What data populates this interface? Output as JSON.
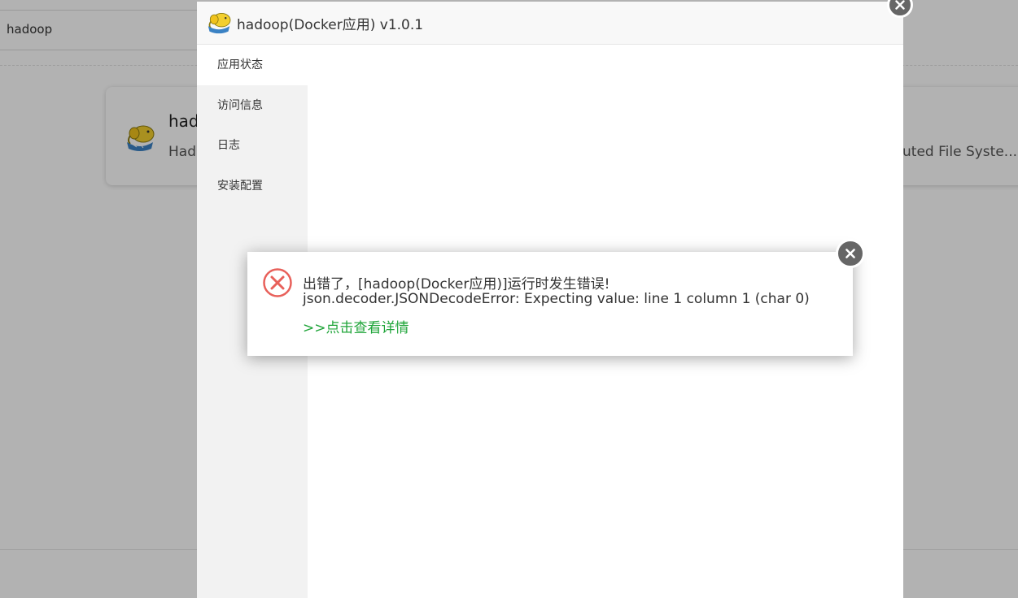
{
  "background": {
    "search": {
      "value": "hadoop"
    },
    "app_card": {
      "title": "had",
      "description_start": "Had",
      "description_end": "buted File Syste...",
      "logo_icon": "hadoop-elephant-icon"
    }
  },
  "app_dialog": {
    "title": "hadoop(Docker应用) v1.0.1",
    "logo_icon": "hadoop-elephant-icon",
    "sidebar": {
      "items": [
        {
          "label": "应用状态",
          "active": true
        },
        {
          "label": "访问信息",
          "active": false
        },
        {
          "label": "日志",
          "active": false
        },
        {
          "label": "安装配置",
          "active": false
        }
      ]
    },
    "close_icon": "close-icon"
  },
  "error_popup": {
    "icon": "error-x-circle-icon",
    "message": "出错了，[hadoop(Docker应用)]运行时发生错误!",
    "detail": "json.decoder.JSONDecodeError: Expecting value: line 1 column 1 (char 0)",
    "link_text": ">>点击查看详情",
    "close_icon": "close-icon"
  },
  "colors": {
    "link_green": "#20a53a",
    "error_red": "#e8605a",
    "close_button_gray": "#666666",
    "overlay": "rgba(0,0,0,0.30)"
  }
}
